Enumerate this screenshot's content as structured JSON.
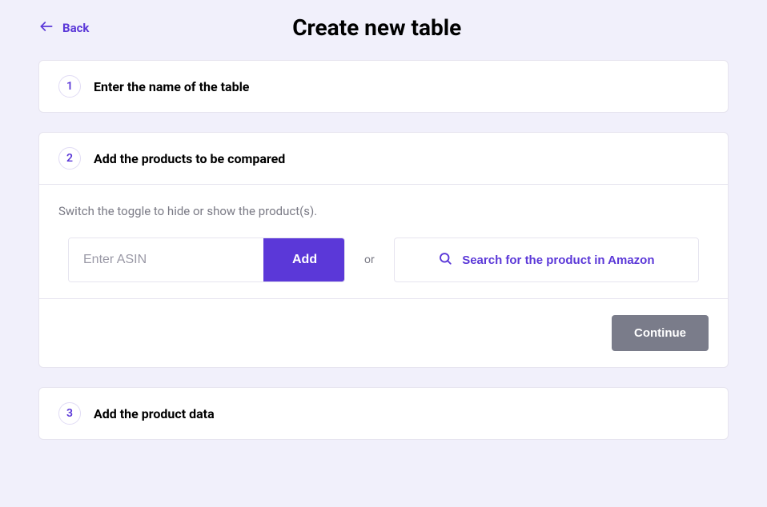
{
  "header": {
    "back_label": "Back",
    "title": "Create new table"
  },
  "steps": {
    "one": {
      "number": "1",
      "title": "Enter the name of the table"
    },
    "two": {
      "number": "2",
      "title": "Add the products to be compared"
    },
    "three": {
      "number": "3",
      "title": "Add the product data"
    }
  },
  "step2": {
    "hint": "Switch the toggle to hide or show the product(s).",
    "asin_placeholder": "Enter ASIN",
    "add_label": "Add",
    "or_label": "or",
    "search_label": "Search for the product in Amazon",
    "continue_label": "Continue"
  },
  "colors": {
    "accent": "#5b38d8",
    "muted_button": "#7a7c8a"
  }
}
